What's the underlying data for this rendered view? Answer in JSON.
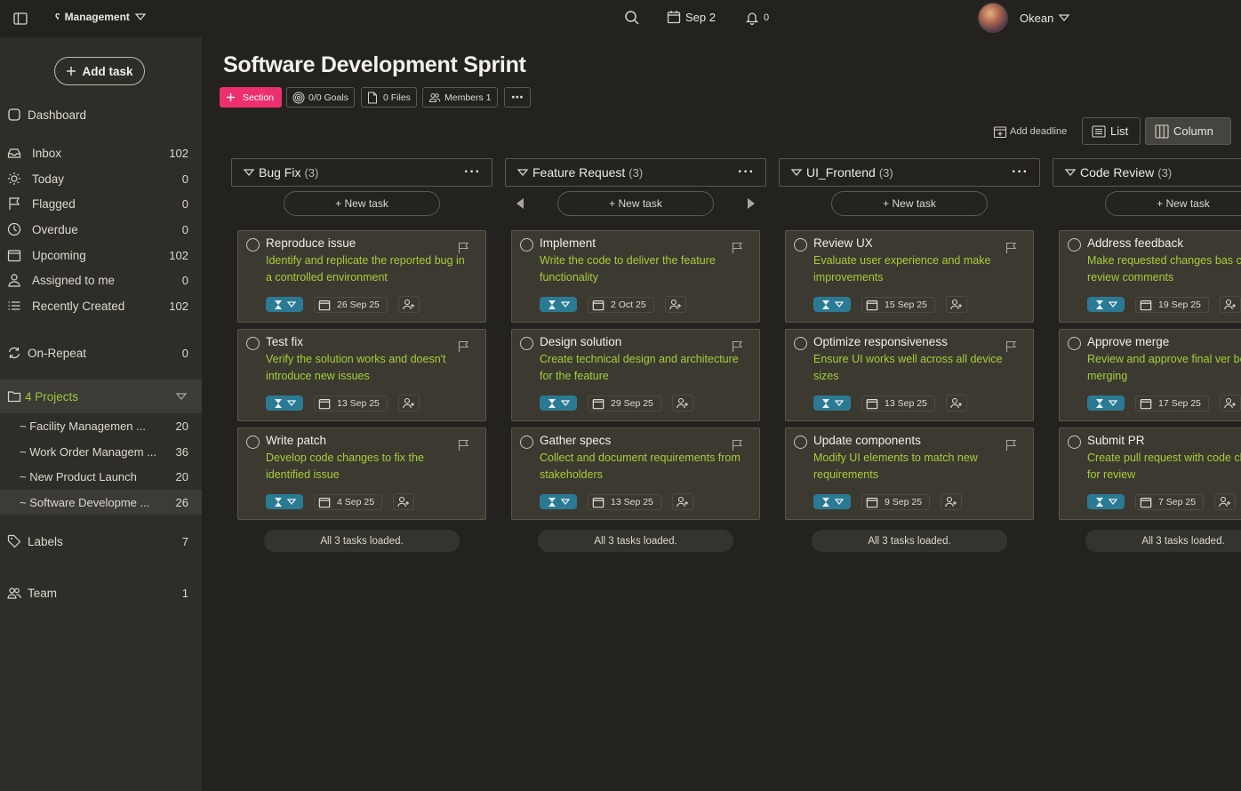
{
  "topbar": {
    "workspace": "Management",
    "date": "Sep 2",
    "notifications": "0",
    "user": "Okean"
  },
  "sidebar": {
    "add_task": "Add task",
    "dashboard": "Dashboard",
    "items": [
      {
        "label": "Inbox",
        "count": "102"
      },
      {
        "label": "Today",
        "count": "0"
      },
      {
        "label": "Flagged",
        "count": "0"
      },
      {
        "label": "Overdue",
        "count": "0"
      },
      {
        "label": "Upcoming",
        "count": "102"
      },
      {
        "label": "Assigned to me",
        "count": "0"
      },
      {
        "label": "Recently Created",
        "count": "102"
      }
    ],
    "on_repeat": {
      "label": "On-Repeat",
      "count": "0"
    },
    "projects_label": "4 Projects",
    "projects": [
      {
        "label": "~ Facility Managemen ...",
        "count": "20"
      },
      {
        "label": "~ Work Order Managem ...",
        "count": "36"
      },
      {
        "label": "~ New Product Launch",
        "count": "20"
      },
      {
        "label": "~ Software Developme ...",
        "count": "26"
      }
    ],
    "labels": {
      "label": "Labels",
      "count": "7"
    },
    "team": {
      "label": "Team",
      "count": "1"
    }
  },
  "main": {
    "title": "Software Development Sprint",
    "chips": {
      "section": "Section",
      "goals": "0/0 Goals",
      "files": "0 Files",
      "members": "Members 1",
      "more": "⋯"
    },
    "add_deadline": "Add deadline",
    "views": {
      "list": "List",
      "column": "Column"
    },
    "new_task_label": "+ New task",
    "columns": [
      {
        "name": "Bug Fix",
        "count": "(3)",
        "loaded": "All 3 tasks loaded.",
        "tasks": [
          {
            "title": "Reproduce issue",
            "desc": "Identify and replicate the reported bug in a controlled environment",
            "due": "26 Sep 25"
          },
          {
            "title": "Test fix",
            "desc": "Verify the solution works and doesn't introduce new issues",
            "due": "13 Sep 25"
          },
          {
            "title": "Write patch",
            "desc": "Develop code changes to fix the identified issue",
            "due": "4 Sep 25"
          }
        ]
      },
      {
        "name": "Feature Request",
        "count": "(3)",
        "loaded": "All 3 tasks loaded.",
        "tasks": [
          {
            "title": "Implement",
            "desc": "Write the code to deliver the feature functionality",
            "due": "2 Oct 25"
          },
          {
            "title": "Design solution",
            "desc": "Create technical design and architecture for the feature",
            "due": "29 Sep 25"
          },
          {
            "title": "Gather specs",
            "desc": "Collect and document requirements from stakeholders",
            "due": "13 Sep 25"
          }
        ]
      },
      {
        "name": "UI_Frontend",
        "count": "(3)",
        "loaded": "All 3 tasks loaded.",
        "tasks": [
          {
            "title": "Review UX",
            "desc": "Evaluate user experience and make improvements",
            "due": "15 Sep 25"
          },
          {
            "title": "Optimize responsiveness",
            "desc": "Ensure UI works well across all device sizes",
            "due": "13 Sep 25"
          },
          {
            "title": "Update components",
            "desc": "Modify UI elements to match new requirements",
            "due": "9 Sep 25"
          }
        ]
      },
      {
        "name": "Code Review",
        "count": "(3)",
        "loaded": "All 3 tasks loaded.",
        "tasks": [
          {
            "title": "Address feedback",
            "desc": "Make requested changes bas code review comments",
            "due": "19 Sep 25"
          },
          {
            "title": "Approve merge",
            "desc": "Review and approve final ver before merging",
            "due": "17 Sep 25"
          },
          {
            "title": "Submit PR",
            "desc": "Create pull request with code changes for review",
            "due": "7 Sep 25"
          }
        ]
      }
    ]
  },
  "colors": {
    "accent": "#ee2f6f",
    "desc_text": "#a5cc3a",
    "priority": "#2b7a93"
  }
}
